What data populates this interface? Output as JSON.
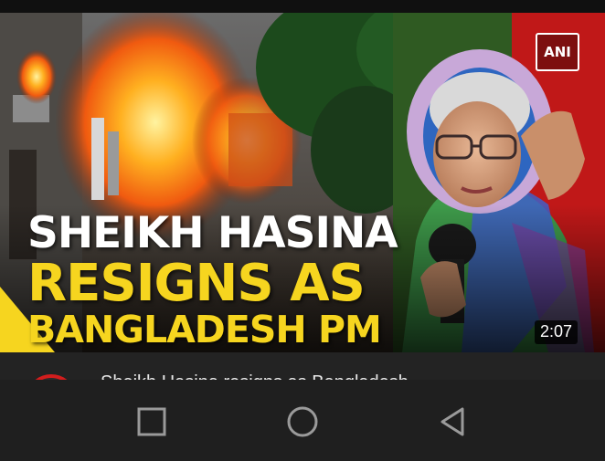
{
  "video": {
    "headline_line1": "SHEIKH HASINA",
    "headline_line2": "RESIGNS AS",
    "headline_line3": "BANGLADESH PM",
    "duration": "2:07",
    "logo_text": "ANI",
    "title_partial": "Sheikh Hasina resigns as Bangladesh"
  },
  "colors": {
    "headline_white": "#ffffff",
    "headline_yellow": "#f6d51f",
    "channel_ring": "#d21d1d",
    "nav_background": "#1f1f1f"
  },
  "nav": {
    "recent_icon": "square-recents-icon",
    "home_icon": "circle-home-icon",
    "back_icon": "triangle-back-icon"
  }
}
